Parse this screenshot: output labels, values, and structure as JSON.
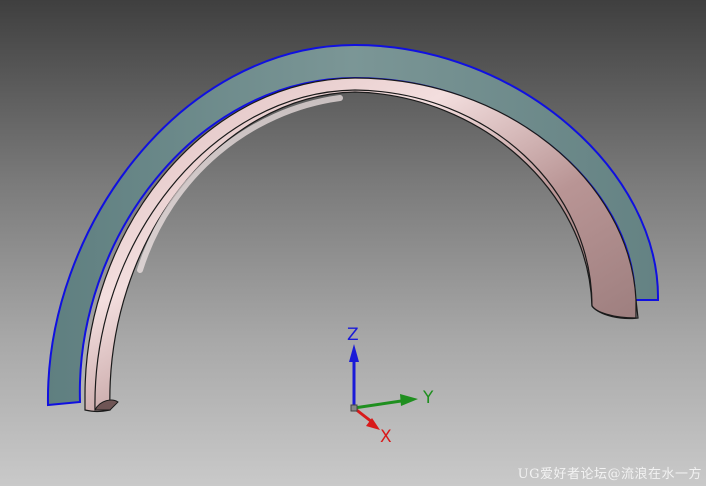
{
  "viewport": {
    "background_top": "#3f3f3f",
    "background_bottom": "#c9c9c9"
  },
  "model": {
    "outer_band_color": "#6f8d8d",
    "outer_band_edge_color": "#1010e0",
    "inner_tube_color": "#c7a3a3",
    "inner_tube_shadow_color": "#8a6e6e"
  },
  "triad": {
    "z_label": "Z",
    "y_label": "Y",
    "x_label": "X",
    "z_color": "#1a1ad8",
    "y_color": "#1f8f1f",
    "x_color": "#d81a1a"
  },
  "watermark": {
    "text": "UG爱好者论坛@流浪在水一方"
  }
}
